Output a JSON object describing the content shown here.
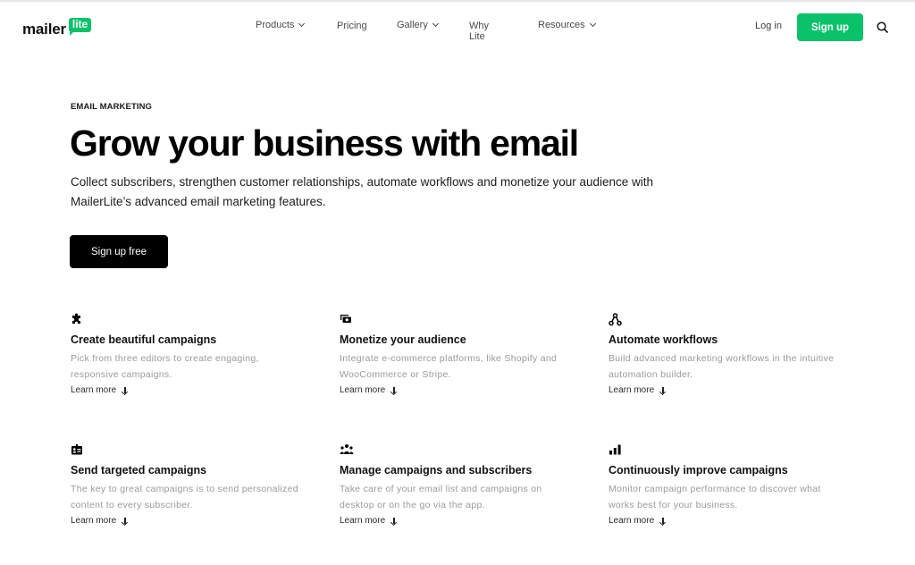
{
  "brand": {
    "name": "mailer",
    "badge": "lite",
    "accent": "#09c269"
  },
  "nav": {
    "items": [
      {
        "label": "Products",
        "dropdown": true
      },
      {
        "label": "Pricing",
        "dropdown": false
      },
      {
        "label": "Gallery",
        "dropdown": true
      },
      {
        "label": "Why Lite",
        "dropdown": false
      },
      {
        "label": "Resources",
        "dropdown": true
      }
    ],
    "login": "Log in",
    "signup": "Sign up",
    "search_icon": "search-icon"
  },
  "hero": {
    "eyebrow": "EMAIL MARKETING",
    "title": "Grow your business with email",
    "lead": "Collect subscribers, strengthen customer relationships, automate workflows and monetize your audience with MailerLite’s advanced email marketing features.",
    "cta": "Sign up free"
  },
  "features": [
    {
      "icon": "puzzle-icon",
      "title": "Create beautiful campaigns",
      "desc": "Pick from three editors to create engaging, responsive campaigns.",
      "link": "Learn more"
    },
    {
      "icon": "money-icon",
      "title": "Monetize your audience",
      "desc": "Integrate e-commerce platforms, like Shopify and WooCommerce or Stripe.",
      "link": "Learn more"
    },
    {
      "icon": "workflow-icon",
      "title": "Automate workflows",
      "desc": "Build advanced marketing workflows in the intuitive automation builder.",
      "link": "Learn more"
    },
    {
      "icon": "id-card-icon",
      "title": "Send targeted campaigns",
      "desc": "The key to great campaigns is to send personalized content to every subscriber.",
      "link": "Learn more"
    },
    {
      "icon": "users-icon",
      "title": "Manage campaigns and subscribers",
      "desc": "Take care of your email list and campaigns on desktop or on the go via the app.",
      "link": "Learn more"
    },
    {
      "icon": "bar-chart-icon",
      "title": "Continuously improve campaigns",
      "desc": "Monitor campaign performance to discover what works best for your business.",
      "link": "Learn more"
    }
  ]
}
